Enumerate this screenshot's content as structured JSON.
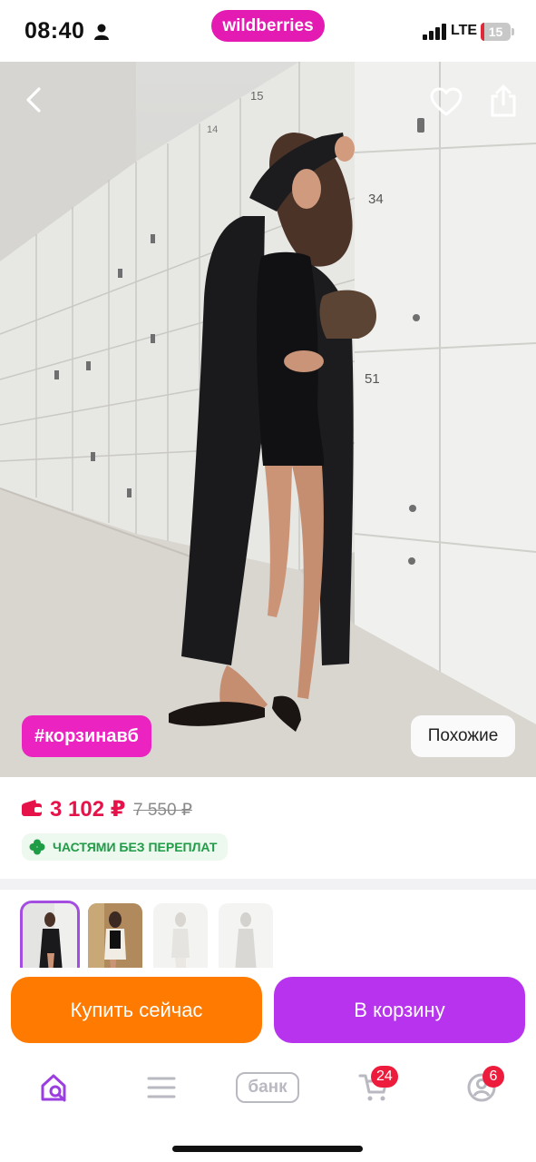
{
  "status_bar": {
    "time": "08:40",
    "network": "LTE",
    "battery": "15"
  },
  "brand": "wildberries",
  "product": {
    "tag": "#корзинавб",
    "similar_label": "Похожие",
    "price": "3 102 ₽",
    "old_price": "7 550 ₽",
    "installment": "ЧАСТЯМИ БЕЗ ПЕРЕПЛАТ",
    "photo_numbers": [
      "15",
      "14",
      "34",
      "51"
    ]
  },
  "actions": {
    "buy_now": "Купить сейчас",
    "add_to_cart": "В корзину"
  },
  "tabbar": {
    "bank_label": "банк",
    "cart_badge": "24",
    "profile_badge": "6"
  },
  "colors": {
    "brand": "#e31bb2",
    "price": "#e5134a",
    "buy": "#ff7a00",
    "cart": "#b833ee",
    "installment": "#1e9c46",
    "badge": "#ee1c3c"
  },
  "icons": [
    "person-icon",
    "signal-icon",
    "back-arrow-icon",
    "heart-icon",
    "share-icon",
    "wallet-icon",
    "clover-icon",
    "home-search-icon",
    "menu-icon",
    "bank-icon",
    "cart-icon",
    "profile-icon"
  ]
}
